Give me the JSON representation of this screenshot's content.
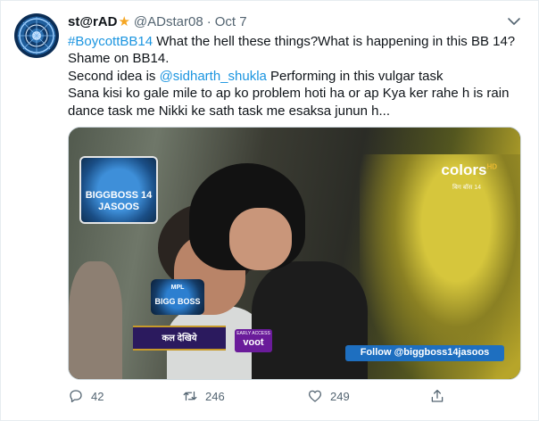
{
  "author": {
    "display_name": "st@rAD",
    "badge_icon": "star-icon",
    "handle": "@ADstar08",
    "separator": "·",
    "date": "Oct 7",
    "avatar_icon": "avatar-emblem-icon"
  },
  "tweet": {
    "lines": [
      {
        "hashtag": "#BoycottBB14",
        "text": " What the hell these things?What is happening in this BB 14?"
      },
      {
        "text": "Shame on BB14."
      },
      {
        "prefix": "Second idea is ",
        "mention": "@sidharth_shukla",
        "suffix": " Performing in this vulgar task"
      },
      {
        "text": "Sana kisi ko gale mile to ap ko problem hoti ha or ap Kya ker rahe h is rain"
      },
      {
        "text": "dance task me Nikki ke sath task me esaksa junun h..."
      }
    ],
    "link_color": "#1b95e0"
  },
  "media": {
    "watermark_top_left": {
      "line1": "BIGGBOSS 14",
      "line2": "JASOOS"
    },
    "channel_logo": "colors",
    "channel_logo_hd": "HD",
    "channel_sub": "बिग बॉस 14",
    "show_logo": {
      "line1": "MPL",
      "line2": "BIGG BOSS"
    },
    "promo_banner": "कल देखिये",
    "voot": {
      "small": "EARLY ACCESS",
      "label": "voot"
    },
    "follow_banner": "Follow @biggboss14jasoos"
  },
  "actions": {
    "reply": {
      "icon": "reply-icon",
      "count": "42"
    },
    "retweet": {
      "icon": "retweet-icon",
      "count": "246"
    },
    "like": {
      "icon": "heart-icon",
      "count": "249"
    },
    "share": {
      "icon": "share-icon"
    }
  },
  "more_icon": "chevron-down-icon"
}
